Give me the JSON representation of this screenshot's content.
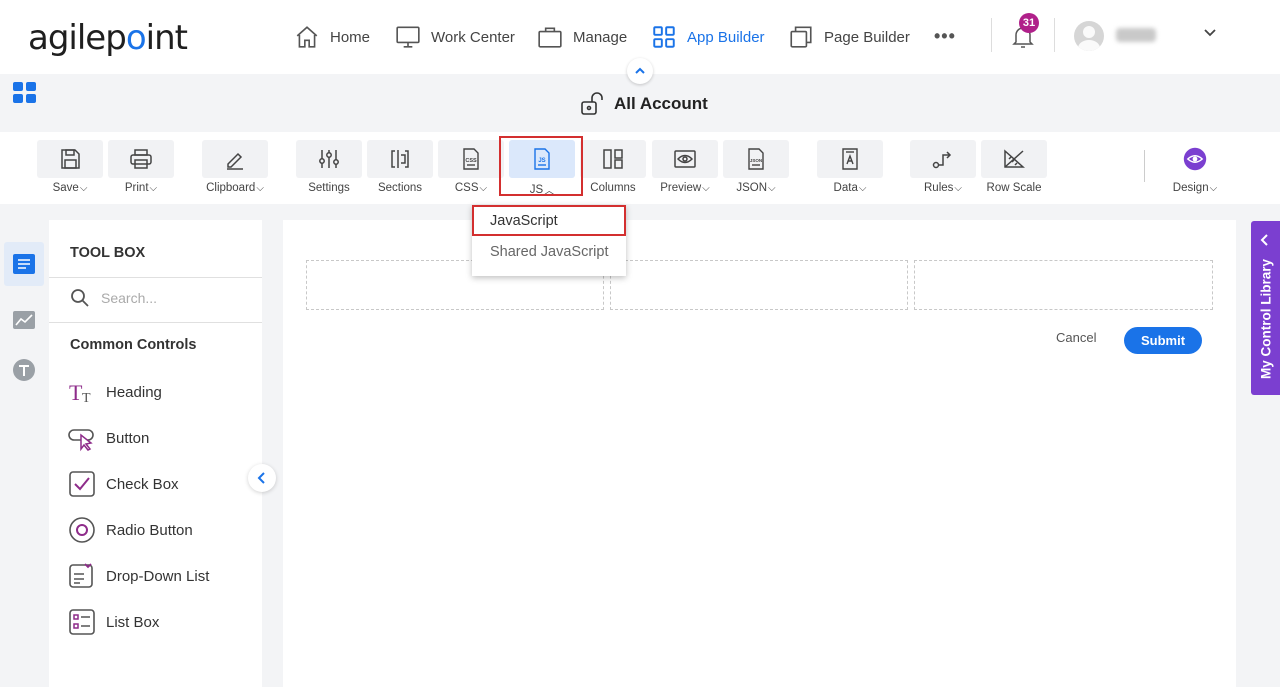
{
  "app": {
    "logo": "agilepoint"
  },
  "nav": {
    "home": "Home",
    "work_center": "Work Center",
    "manage": "Manage",
    "app_builder": "App Builder",
    "page_builder": "Page Builder",
    "more": "•••",
    "notifications_count": "31",
    "active_color": "#1a73e8"
  },
  "header": {
    "title": "All Account"
  },
  "toolbar": {
    "save": "Save",
    "print": "Print",
    "clipboard": "Clipboard",
    "settings": "Settings",
    "sections": "Sections",
    "css": "CSS",
    "js": "JS",
    "columns": "Columns",
    "preview": "Preview",
    "json": "JSON",
    "data": "Data",
    "rules": "Rules",
    "row_scale": "Row Scale",
    "design": "Design"
  },
  "js_menu": {
    "items": [
      "JavaScript",
      "Shared JavaScript"
    ]
  },
  "toolbox": {
    "title": "TOOL BOX",
    "search_placeholder": "Search...",
    "group_title": "Common Controls",
    "controls": [
      "Heading",
      "Button",
      "Check Box",
      "Radio Button",
      "Drop-Down List",
      "List Box"
    ],
    "icon_color": "#8e2c8a"
  },
  "canvas": {
    "cancel": "Cancel",
    "submit": "Submit"
  },
  "control_library": {
    "label": "My Control Library",
    "color": "#7b3fd0"
  }
}
